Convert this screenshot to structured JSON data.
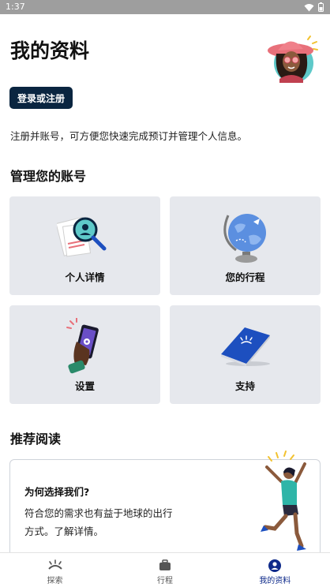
{
  "status_bar": {
    "time": "1:37"
  },
  "header": {
    "title": "我的资料"
  },
  "login_button": "登录或注册",
  "intro": "注册并账号，可方便您快速完成预订并管理个人信息。",
  "manage_section": {
    "title": "管理您的账号",
    "cards": [
      {
        "label": "个人详情",
        "icon": "profile-magnifier-icon"
      },
      {
        "label": "您的行程",
        "icon": "globe-icon"
      },
      {
        "label": "设置",
        "icon": "phone-settings-icon"
      },
      {
        "label": "支持",
        "icon": "book-icon"
      }
    ]
  },
  "reading_section": {
    "title": "推荐阅读",
    "article": {
      "title": "为何选择我们?",
      "description": "符合您的需求也有益于地球的出行方式。了解详情。"
    }
  },
  "bottom_nav": {
    "items": [
      {
        "label": "探索",
        "icon": "sunrise-icon",
        "active": false
      },
      {
        "label": "行程",
        "icon": "suitcase-icon",
        "active": false
      },
      {
        "label": "我的资料",
        "icon": "user-circle-icon",
        "active": true
      }
    ]
  },
  "colors": {
    "primary_dark": "#0a2540",
    "accent_blue": "#0e2a8a",
    "card_bg": "#e6e8ed"
  }
}
